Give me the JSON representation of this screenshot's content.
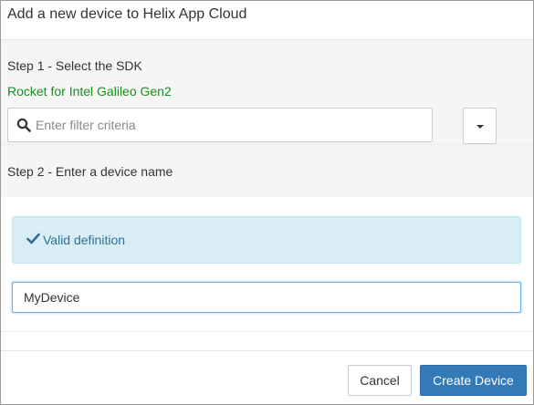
{
  "header": {
    "title": "Add a new device to Helix App Cloud"
  },
  "step1": {
    "label": "Step 1 - Select the SDK",
    "selected_sdk": "Rocket for Intel Galileo Gen2",
    "filter_placeholder": "Enter filter criteria",
    "filter_value": ""
  },
  "step2": {
    "label": "Step 2 - Enter a device name",
    "alert_text": "Valid definition",
    "device_name_value": "MyDevice"
  },
  "footer": {
    "cancel_label": "Cancel",
    "create_label": "Create Device"
  },
  "icons": {
    "search": "search-icon",
    "check": "check-icon",
    "dropdown": "caret-down-icon"
  },
  "colors": {
    "selected_sdk": "#12941b",
    "alert_bg": "#d9edf7",
    "alert_text": "#31708f",
    "primary_button": "#337ab7"
  }
}
